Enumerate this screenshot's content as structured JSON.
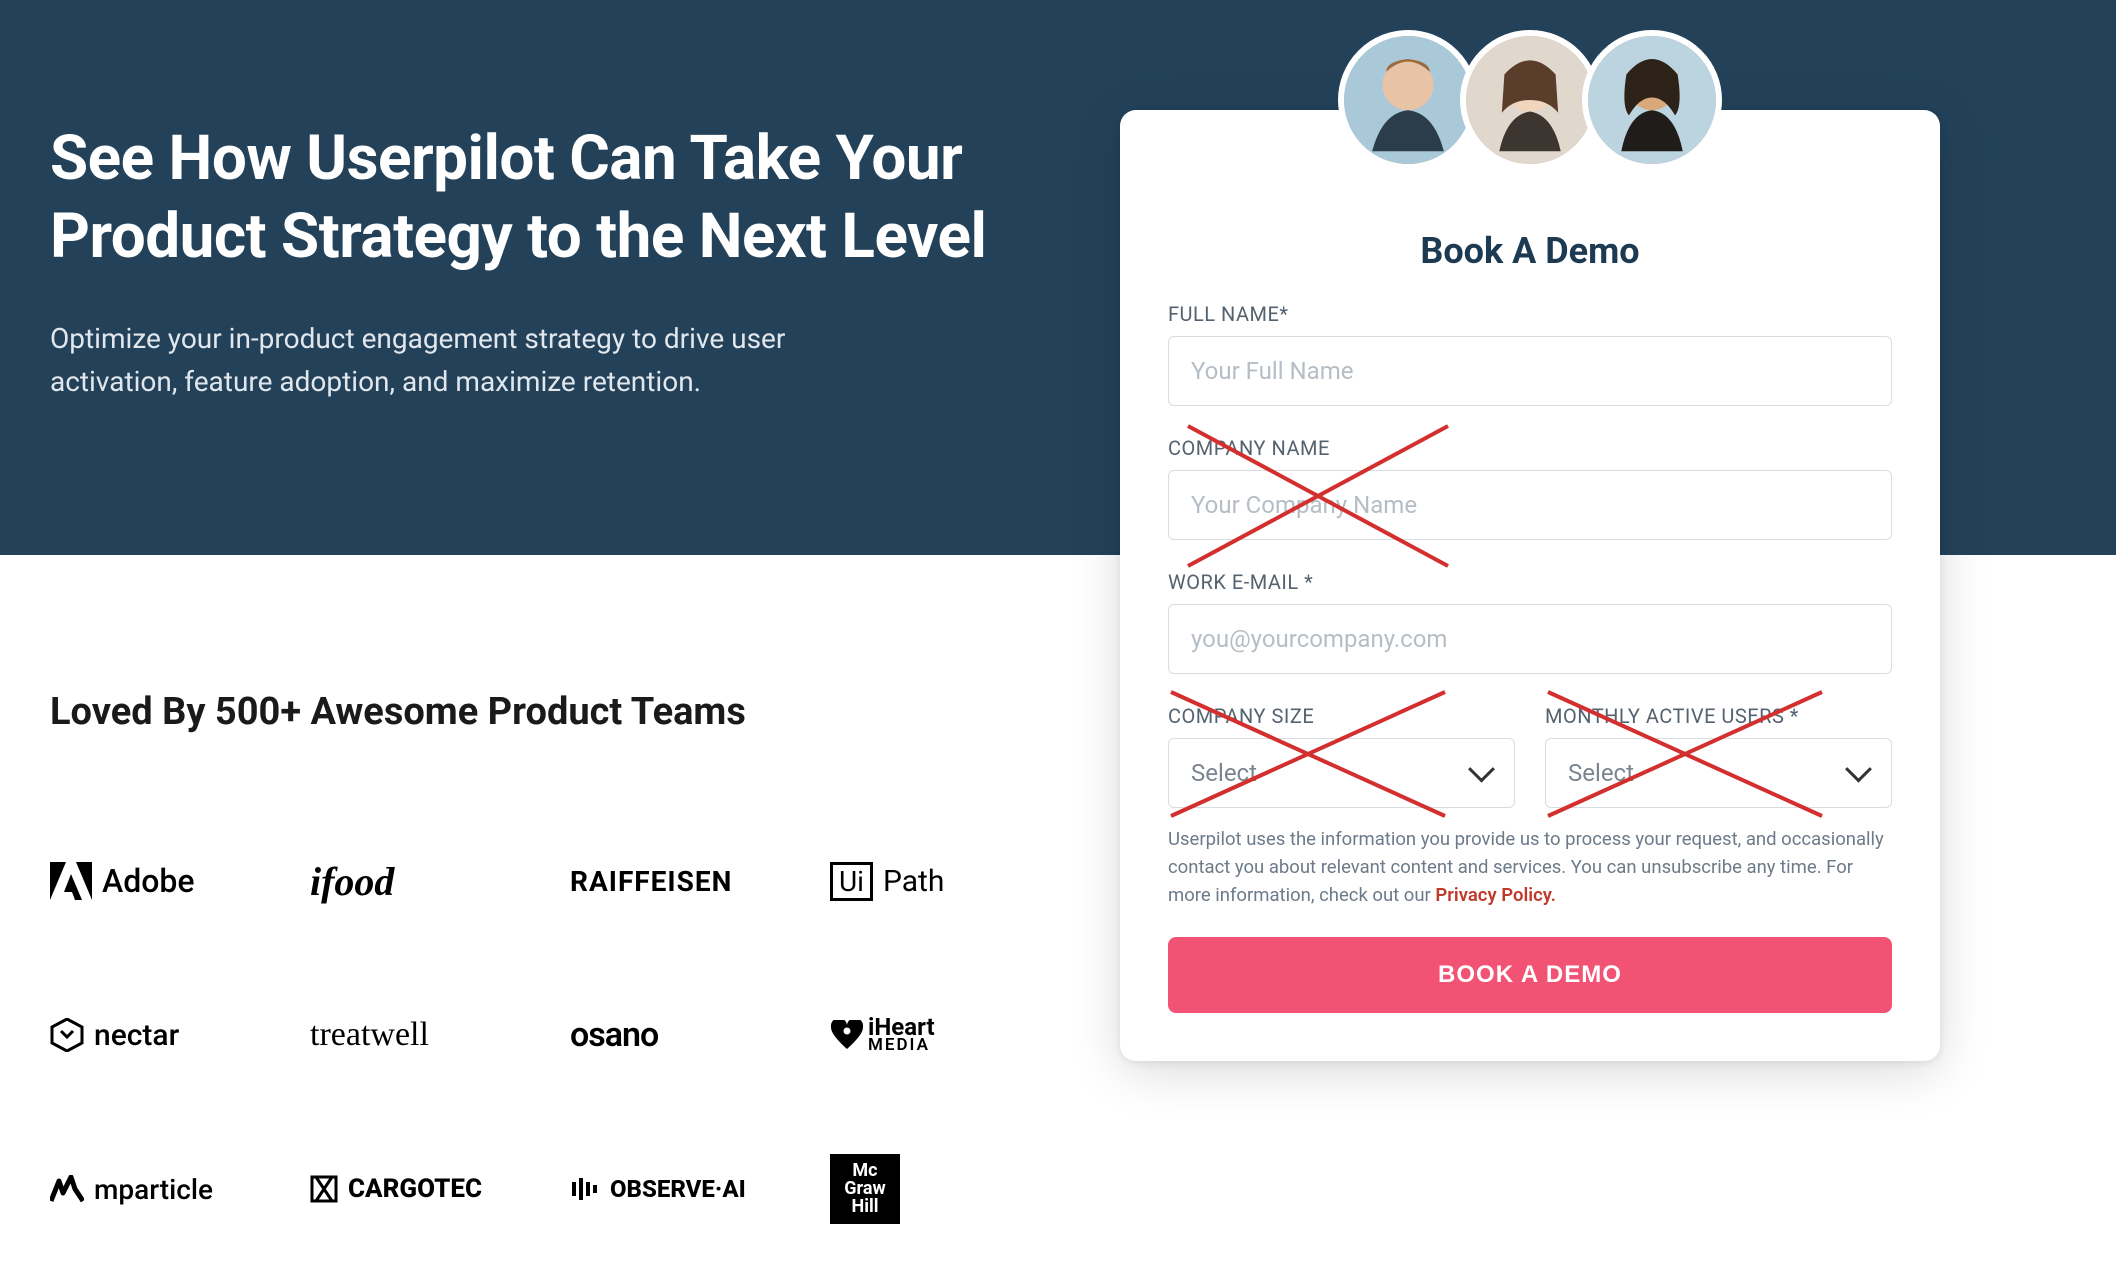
{
  "hero": {
    "title": "See How Userpilot Can Take Your Product Strategy to the Next Level",
    "subtitle": "Optimize your in-product engagement strategy to drive user activation, feature adoption, and maximize retention."
  },
  "social": {
    "title": "Loved By 500+ Awesome Product Teams",
    "logos": [
      "Adobe",
      "ifood",
      "RAIFFEISEN",
      "UiPath",
      "nectar",
      "treatwell",
      "osano",
      "iHeart MEDIA",
      "mparticle",
      "CARGOTEC",
      "OBSERVE·AI",
      "Mc Graw Hill"
    ]
  },
  "form": {
    "title": "Book A Demo",
    "fullname_label": "FULL NAME*",
    "fullname_placeholder": "Your Full Name",
    "company_label": "COMPANY NAME",
    "company_placeholder": "Your Company Name",
    "email_label": "WORK E-MAIL *",
    "email_placeholder": "you@yourcompany.com",
    "size_label": "COMPANY SIZE",
    "size_selected": "Select",
    "mau_label": "MONTHLY ACTIVE USERS *",
    "mau_selected": "Select",
    "privacy_text_1": "Userpilot uses the information you provide us to process your request, and occasionally contact you about relevant content and services. You can unsubscribe any time. For more information, check out our ",
    "privacy_link": "Privacy Policy.",
    "submit": "BOOK A DEMO"
  }
}
